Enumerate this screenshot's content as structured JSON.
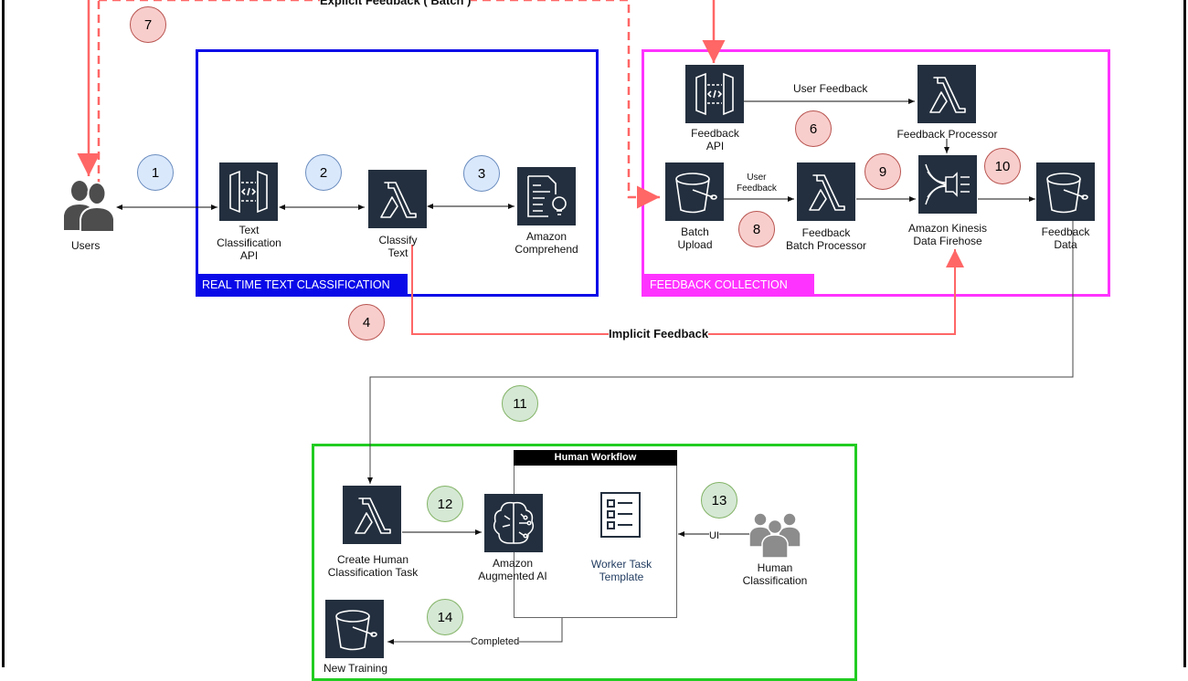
{
  "groups": {
    "realtime": {
      "label": "REAL TIME TEXT CLASSIFICATION",
      "color": "#0a0ae8"
    },
    "feedback": {
      "label": "FEEDBACK COLLECTION",
      "color": "#ff33ff"
    },
    "human": {
      "label": "",
      "color": "#22cc22"
    },
    "human_workflow": {
      "label": "Human Workflow"
    }
  },
  "nodes": {
    "users": {
      "label": "Users",
      "icon": "users-icon"
    },
    "text_api": {
      "label": "Text\nClassification\nAPI",
      "icon": "api-gateway-icon"
    },
    "classify": {
      "label": "Classify\nText",
      "icon": "lambda-icon"
    },
    "comprehend": {
      "label": "Amazon\nComprehend",
      "icon": "comprehend-icon"
    },
    "feedback_api": {
      "label": "Feedback\nAPI",
      "icon": "api-gateway-icon"
    },
    "feedback_processor": {
      "label": "Feedback Processor",
      "icon": "lambda-icon"
    },
    "batch_upload": {
      "label": "Batch\nUpload",
      "icon": "s3-bucket-icon"
    },
    "batch_processor": {
      "label": "Feedback\nBatch Processor",
      "icon": "lambda-icon"
    },
    "kinesis": {
      "label": "Amazon Kinesis\nData Firehose",
      "icon": "kinesis-firehose-icon"
    },
    "feedback_data": {
      "label": "Feedback\nData",
      "icon": "s3-bucket-icon"
    },
    "create_task": {
      "label": "Create Human\nClassification Task",
      "icon": "lambda-icon"
    },
    "a2i": {
      "label": "Amazon\nAugmented AI",
      "icon": "augmented-ai-icon"
    },
    "worker_template": {
      "label": "Worker Task\nTemplate",
      "icon": "task-template-icon"
    },
    "human_classification": {
      "label": "Human\nClassification",
      "icon": "team-icon"
    },
    "new_training": {
      "label": "New Training",
      "icon": "s3-bucket-icon"
    }
  },
  "edge_labels": {
    "explicit_batch": "Explicit Feedback ( Batch )",
    "implicit": "Implicit Feedback",
    "user_feedback": "User Feedback",
    "user_feedback_small": "User\nFeedback",
    "ui": "UI",
    "completed": "Completed"
  },
  "steps": [
    "1",
    "2",
    "3",
    "4",
    "6",
    "7",
    "8",
    "9",
    "10",
    "11",
    "12",
    "13",
    "14"
  ],
  "colors": {
    "feedback_arrow": "#ff6666",
    "service_bg": "#232f3e",
    "step_blue": "#dae8fc",
    "step_red": "#f8cecc",
    "step_green": "#d5e8d4"
  }
}
